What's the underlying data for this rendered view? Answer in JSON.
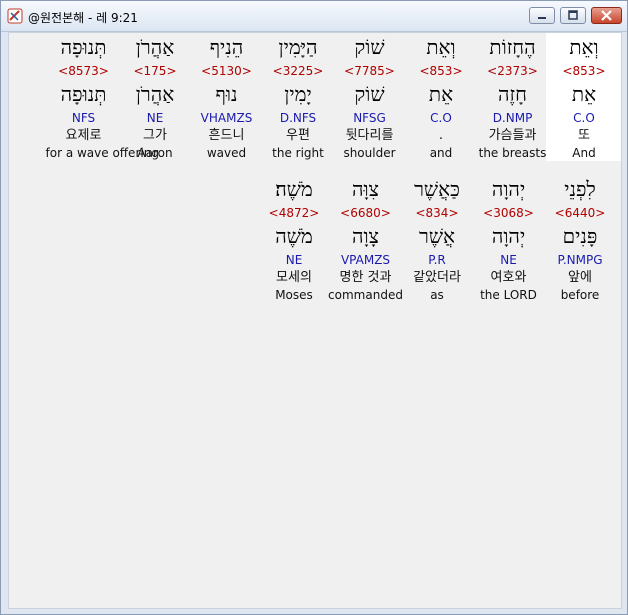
{
  "window": {
    "title": "@원전본해 - 레 9:21"
  },
  "row1": [
    {
      "heb": "וְאֵת",
      "strong": "<853>",
      "lemma": "אֵת",
      "morph": "C.O",
      "kor": "또",
      "eng": "And"
    },
    {
      "heb": "הֶחָזוֹת",
      "strong": "<2373>",
      "lemma": "חָזֶה",
      "morph": "D.NMP",
      "kor": "가슴들과",
      "eng": "the breasts"
    },
    {
      "heb": "וְאֵת",
      "strong": "<853>",
      "lemma": "אֵת",
      "morph": "C.O",
      "kor": ".",
      "eng": "and"
    },
    {
      "heb": "שׁוֹק",
      "strong": "<7785>",
      "lemma": "שׁוֹק",
      "morph": "NFSG",
      "kor": "뒷다리를",
      "eng": "shoulder"
    },
    {
      "heb": "הַיָּמִין",
      "strong": "<3225>",
      "lemma": "יָמִין",
      "morph": "D.NFS",
      "kor": "우편",
      "eng": "the right"
    },
    {
      "heb": "הֵנִיף",
      "strong": "<5130>",
      "lemma": "נוּף",
      "morph": "VHAMZS",
      "kor": "흔드니",
      "eng": "waved"
    },
    {
      "heb": "אַהֲרֹן",
      "strong": "<175>",
      "lemma": "אַהֲרֹן",
      "morph": "NE",
      "kor": "그가",
      "eng": "Aaron"
    },
    {
      "heb": "תְּנוּפָה",
      "strong": "<8573>",
      "lemma": "תְּנוּפָה",
      "morph": "NFS",
      "kor": "요제로",
      "eng": "for a wave offering"
    }
  ],
  "row2": [
    {
      "heb": "לִפְנֵי",
      "strong": "<6440>",
      "lemma": "פָּנִים",
      "morph": "P.NMPG",
      "kor": "앞에",
      "eng": "before"
    },
    {
      "heb": "יְהוָה",
      "strong": "<3068>",
      "lemma": "יְהוָה",
      "morph": "NE",
      "kor": "여호와",
      "eng": "the LORD"
    },
    {
      "heb": "כַּאֲשֶׁר",
      "strong": "<834>",
      "lemma": "אֲשֶׁר",
      "morph": "P.R",
      "kor": "같았더라",
      "eng": "as"
    },
    {
      "heb": "צִוָּה",
      "strong": "<6680>",
      "lemma": "צָוָה",
      "morph": "VPAMZS",
      "kor": "명한 것과",
      "eng": "commanded"
    },
    {
      "heb": "מֹשֶׁה׃",
      "strong": "<4872>",
      "lemma": "מֹשֶׁה",
      "morph": "NE",
      "kor": "모세의",
      "eng": "Moses"
    }
  ]
}
